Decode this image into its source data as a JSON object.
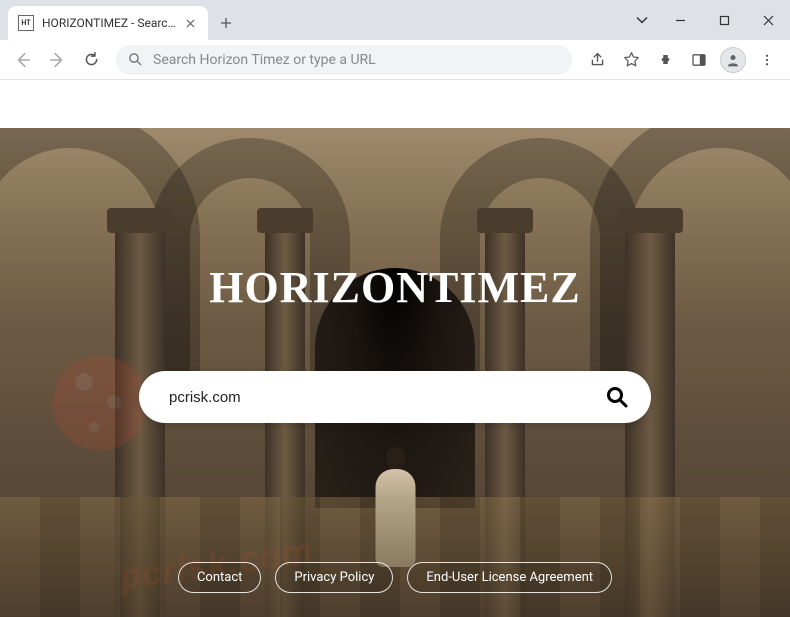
{
  "browser": {
    "tab": {
      "favicon_text": "HT",
      "title": "HORIZONTIMEZ - Search With U"
    },
    "omnibox_placeholder": "Search Horizon Timez or type a URL"
  },
  "page": {
    "brand": "HORIZONTIMEZ",
    "search_value": "pcrisk.com",
    "footer": {
      "contact": "Contact",
      "privacy": "Privacy Policy",
      "eula": "End-User License Agreement"
    }
  },
  "watermark_text": "pcrisk.com"
}
